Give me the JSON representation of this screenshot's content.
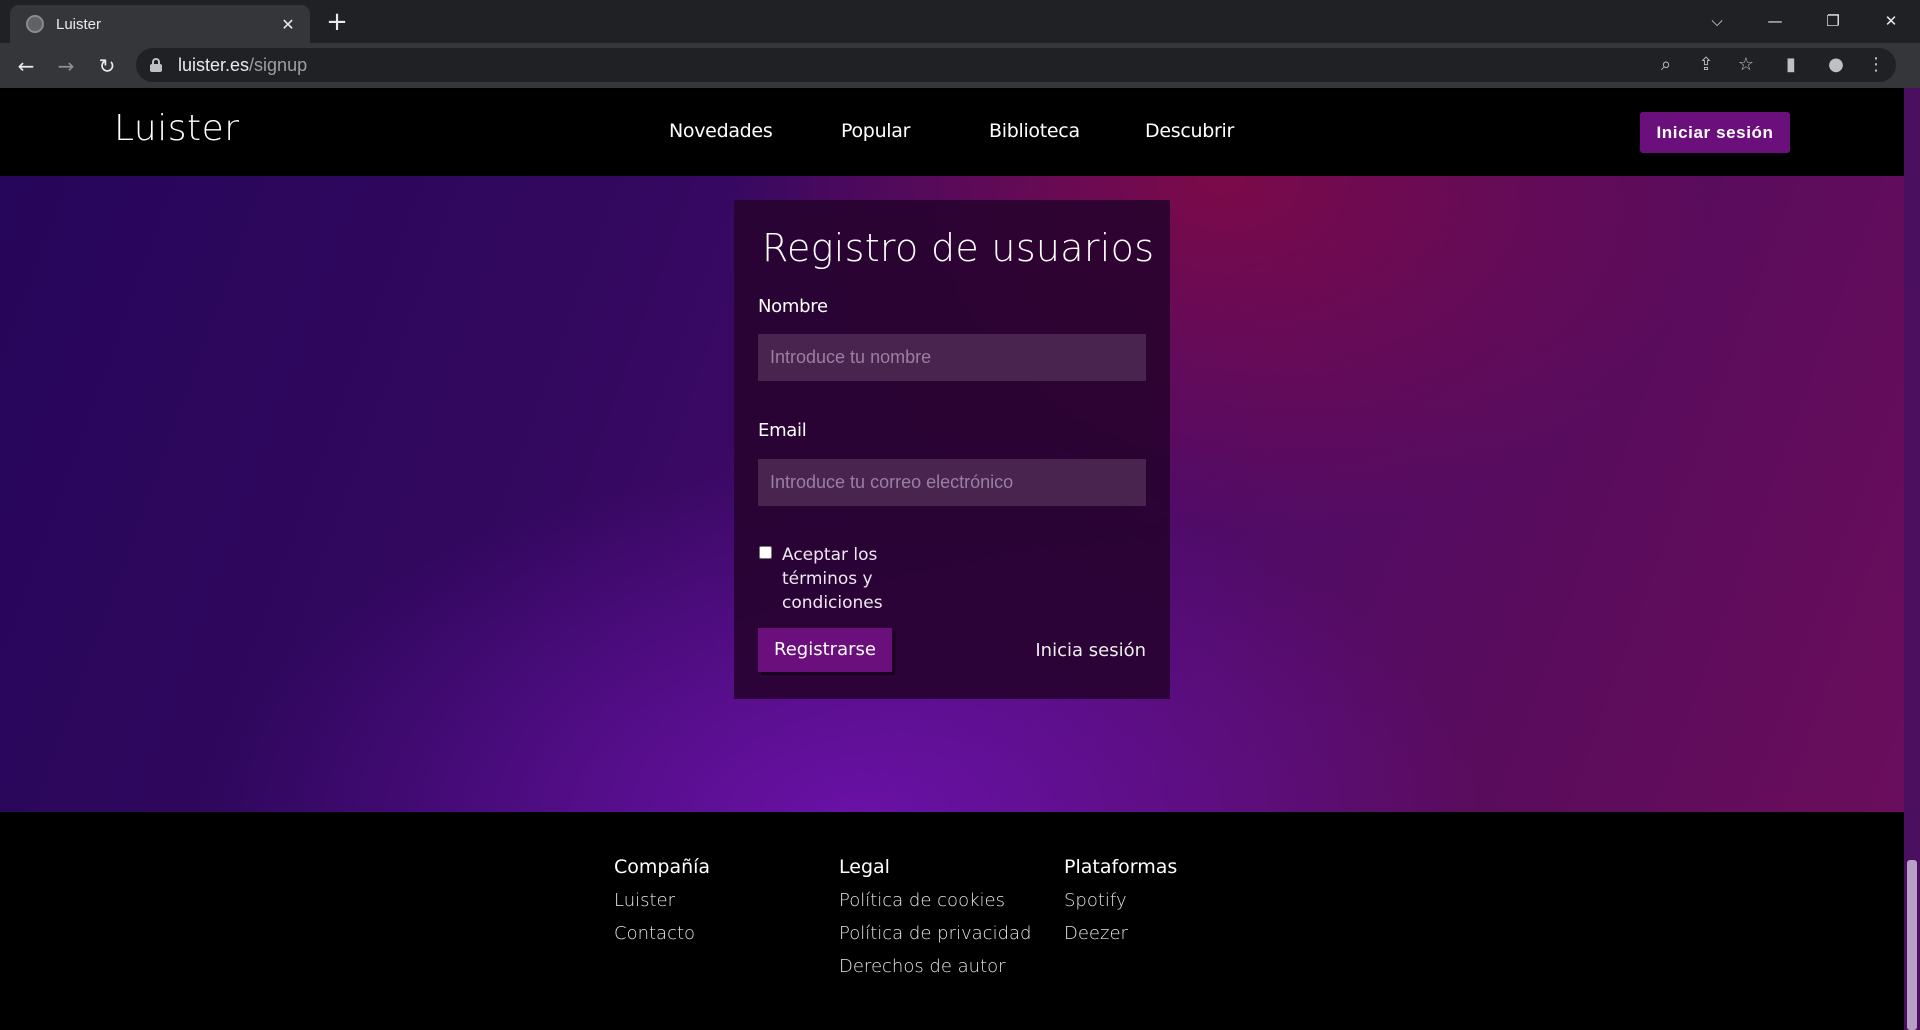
{
  "browser": {
    "tab_title": "Luister",
    "tab_close": "✕",
    "new_tab": "+",
    "url_host": "luister.es",
    "url_path": "/signup",
    "controls": {
      "dropdown": "⌵",
      "minimize": "—",
      "restore": "❐",
      "close": "✕"
    },
    "toolbar_icons": {
      "back": "←",
      "forward": "→",
      "reload": "↻",
      "zoom": "⌕",
      "share": "⇪",
      "bookmark": "☆",
      "sidepanel": "▮",
      "profile": "●",
      "menu": "⋮"
    }
  },
  "site": {
    "logo": "Luister",
    "nav": [
      "Novedades",
      "Popular",
      "Biblioteca",
      "Descubrir"
    ],
    "login_button": "Iniciar sesión"
  },
  "form": {
    "title": "Registro de usuarios",
    "name_label": "Nombre",
    "name_placeholder": "Introduce tu nombre",
    "email_label": "Email",
    "email_placeholder": "Introduce tu correo electrónico",
    "terms_label": "Aceptar los términos y condiciones",
    "terms_checked": false,
    "submit_label": "Registrarse",
    "login_link": "Inicia sesión"
  },
  "footer": {
    "columns": [
      {
        "heading": "Compañía",
        "links": [
          "Luister",
          "Contacto"
        ]
      },
      {
        "heading": "Legal",
        "links": [
          "Política de cookies",
          "Política de privacidad",
          "Derechos de autor"
        ]
      },
      {
        "heading": "Plataformas",
        "links": [
          "Spotify",
          "Deezer"
        ]
      }
    ]
  },
  "colors": {
    "accent": "#6a0f7b",
    "card_bg": "#26022c",
    "input_bg": "#48244f",
    "chrome_dark": "#202124",
    "chrome_toolbar": "#35363a"
  }
}
